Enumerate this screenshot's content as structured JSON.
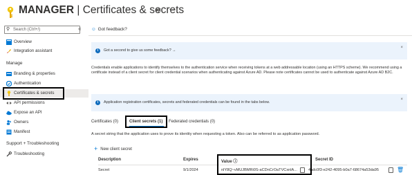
{
  "header": {
    "title_bold": "MANAGER",
    "title_rest": " | Certificates & secrets",
    "pin_icon": "pin-icon",
    "more_icon": "more-icon"
  },
  "sidebar": {
    "search_placeholder": "Search (Ctrl+/)",
    "collapse_glyph": "«",
    "items_top": [
      {
        "label": "Overview",
        "icon": "grid-icon"
      },
      {
        "label": "Integration assistant",
        "icon": "rocket-icon"
      }
    ],
    "section_manage": "Manage",
    "items_manage": [
      {
        "label": "Branding & properties",
        "icon": "branding-icon"
      },
      {
        "label": "Authentication",
        "icon": "auth-icon"
      },
      {
        "label": "Certificates & secrets",
        "icon": "key-icon"
      },
      {
        "label": "API permissions",
        "icon": "api-icon"
      },
      {
        "label": "Expose an API",
        "icon": "cloud-icon"
      },
      {
        "label": "Owners",
        "icon": "people-icon"
      },
      {
        "label": "Manifest",
        "icon": "manifest-icon"
      }
    ],
    "section_support": "Support + Troubleshooting",
    "items_support": [
      {
        "label": "Troubleshooting",
        "icon": "wrench-icon"
      }
    ]
  },
  "main": {
    "feedback": "Got feedback?",
    "banner1": "Got a second to give us some feedback? →",
    "banner_close": "×",
    "description": "Credentials enable applications to identify themselves to the authentication service when receiving tokens at a web addressable location (using an HTTPS scheme). We recommend using a certificate instead of a client secret for client credential scenarios when authenticating against Azure AD. Please note certificates cannot be used to authenticate against Azure AD B2C.",
    "banner2": "Application registration certificates, secrets and federated credentials can be found in the tabs below.",
    "tabs": [
      {
        "label": "Certificates (0)"
      },
      {
        "label": "Client secrets (1)"
      },
      {
        "label": "Federated credentials (0)"
      }
    ],
    "tab_description": "A secret string that the application uses to prove its identity when requesting a token. Also can be referred to as application password.",
    "new_secret": "New client secret",
    "table": {
      "headers": [
        "Description",
        "Expires",
        "Value ⓘ",
        "Secret ID"
      ],
      "rows": [
        {
          "description": "Secret",
          "expires": "9/1/2024",
          "value": "nlY8Q~vMUJBMRi0S-aCDnCrOaTVCxnlA...",
          "secret_id": "4adc0f3-e242-4095-b0a7-68674a53da95"
        }
      ]
    }
  },
  "colors": {
    "accent": "#0078d4",
    "banner_bg": "#ebf3fc",
    "key_yellow": "#f2c811"
  }
}
